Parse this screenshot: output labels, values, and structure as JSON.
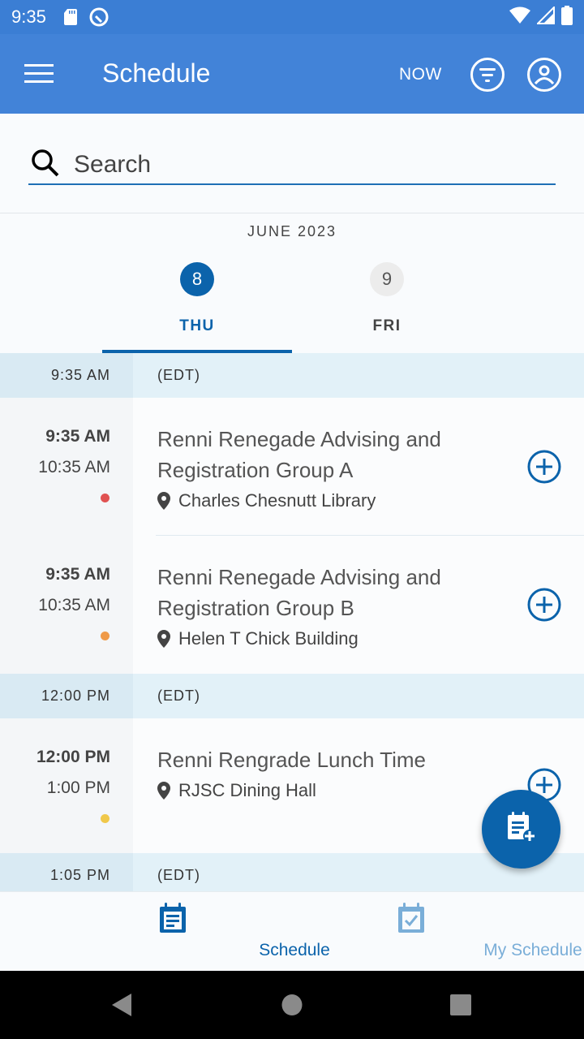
{
  "status_bar": {
    "time": "9:35",
    "icons": [
      "sd-card-icon",
      "data-saver-icon",
      "wifi-icon",
      "signal-icon",
      "battery-icon"
    ]
  },
  "app_bar": {
    "title": "Schedule",
    "now_label": "NOW",
    "icons": [
      "menu-icon",
      "filter-icon",
      "profile-icon"
    ]
  },
  "search": {
    "placeholder": "Search",
    "value": ""
  },
  "date_picker": {
    "month": "JUNE 2023",
    "days": [
      {
        "number": "8",
        "weekday": "THU",
        "selected": true
      },
      {
        "number": "9",
        "weekday": "FRI",
        "selected": false
      }
    ]
  },
  "schedule": [
    {
      "group_time": "9:35 AM",
      "timezone": "(EDT)",
      "events": [
        {
          "start": "9:35 AM",
          "end": "10:35 AM",
          "title": "Renni Renegade Advising and Registration Group A",
          "location": "Charles Chesnutt Library",
          "dot_color": "#e05252"
        },
        {
          "start": "9:35 AM",
          "end": "10:35 AM",
          "title": "Renni Renegade Advising and Registration Group B",
          "location": "Helen T Chick Building",
          "dot_color": "#ef9a48"
        }
      ]
    },
    {
      "group_time": "12:00 PM",
      "timezone": "(EDT)",
      "events": [
        {
          "start": "12:00 PM",
          "end": "1:00 PM",
          "title": "Renni Rengrade Lunch Time",
          "location": "RJSC Dining Hall",
          "dot_color": "#f0c84a"
        }
      ]
    },
    {
      "group_time": "1:05 PM",
      "timezone": "(EDT)",
      "events": []
    }
  ],
  "fab": {
    "icon": "add-to-schedule-icon"
  },
  "bottom_nav": {
    "items": [
      {
        "label": "Schedule",
        "active": true
      },
      {
        "label": "My Schedule",
        "active": false
      }
    ]
  },
  "colors": {
    "app_bar": "#4283d8",
    "status_bar": "#3b7ed4",
    "primary": "#0b63ab",
    "inactive_nav": "#7aaed8",
    "group_header": "#e2f1f8"
  }
}
